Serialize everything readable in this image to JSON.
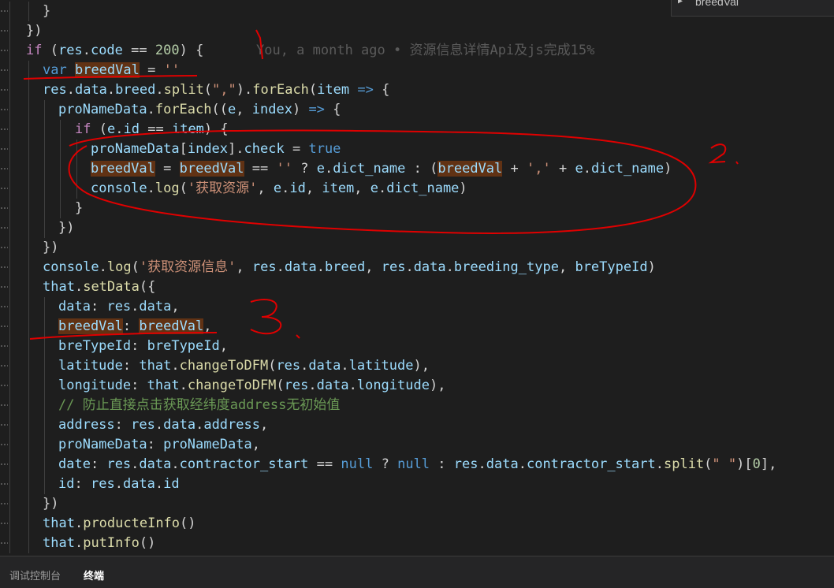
{
  "find_widget": {
    "query": "breedVal",
    "arrow": "▶"
  },
  "code": [
    "}",
    "})",
    "if (res.code == 200) {",
    "var breedVal = ''",
    "res.data.breed.split(\",\").forEach(item => {",
    "proNameData.forEach((e, index) => {",
    "if (e.id == item) {",
    "proNameData[index].check = true",
    "breedVal = breedVal == '' ? e.dict_name : (breedVal + ',' + e.dict_name)",
    "console.log('获取资源', e.id, item, e.dict_name)",
    "}",
    "})",
    "})",
    "console.log('获取资源信息', res.data.breed, res.data.breeding_type, breTypeId)",
    "that.setData({",
    "data: res.data,",
    "breedVal: breedVal,",
    "breTypeId: breTypeId,",
    "latitude: that.changeToDFM(res.data.latitude),",
    "longitude: that.changeToDFM(res.data.longitude),",
    "// 防止直接点击获取经纬度address无初始值",
    "address: res.data.address,",
    "proNameData: proNameData,",
    "date: res.data.contractor_start == null ? null : res.data.contractor_start.split(\" \")[0],",
    "id: res.data.id",
    "})",
    "that.producteInfo()",
    "that.putInfo()"
  ],
  "blame": "You, a month ago • 资源信息详情Api及js完成15%",
  "annotations": [
    "1",
    "2",
    "3"
  ],
  "panel": {
    "tabs": [
      {
        "label": "调试控制台",
        "active": false
      },
      {
        "label": "终端",
        "active": true
      }
    ]
  },
  "colors": {
    "background": "#1e1e1e",
    "keyword": "#569cd6",
    "control": "#c586c0",
    "variable": "#9cdcfe",
    "function": "#dcdcaa",
    "string": "#ce9178",
    "number": "#b5cea8",
    "comment": "#6a9955",
    "annotation_ink": "#e00000",
    "match_highlight": "#613214"
  }
}
